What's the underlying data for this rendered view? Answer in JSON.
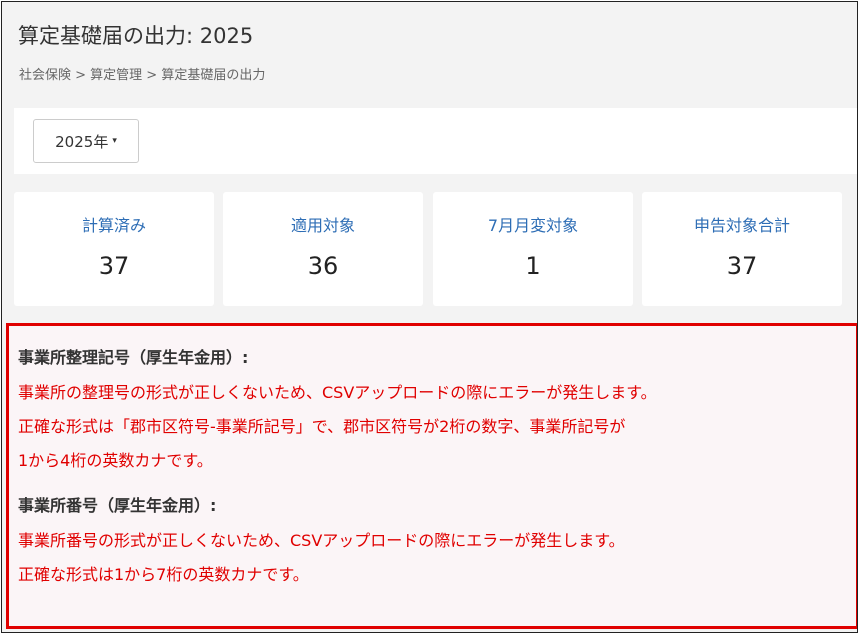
{
  "header": {
    "title": "算定基礎届の出力: 2025",
    "breadcrumb": "社会保険 > 算定管理 > 算定基礎届の出力"
  },
  "filter": {
    "year_label": "2025年",
    "caret": "▾"
  },
  "stats": [
    {
      "label": "計算済み",
      "value": "37"
    },
    {
      "label": "適用対象",
      "value": "36"
    },
    {
      "label": "7月月変対象",
      "value": "1"
    },
    {
      "label": "申告対象合計",
      "value": "37"
    }
  ],
  "notices": [
    {
      "heading": "事業所整理記号（厚生年金用）:",
      "lines": [
        "事業所の整理号の形式が正しくないため、CSVアップロードの際にエラーが発生します。",
        "正確な形式は「郡市区符号-事業所記号」で、郡市区符号が2桁の数字、事業所記号が",
        "1から4桁の英数カナです。"
      ]
    },
    {
      "heading": "事業所番号（厚生年金用）:",
      "lines": [
        "事業所番号の形式が正しくないため、CSVアップロードの際にエラーが発生します。",
        "正確な形式は1から7桁の英数カナです。"
      ]
    }
  ],
  "colors": {
    "accent_blue": "#2d6db5",
    "error_red": "#e00000",
    "notice_bg": "#fbf5f7"
  }
}
